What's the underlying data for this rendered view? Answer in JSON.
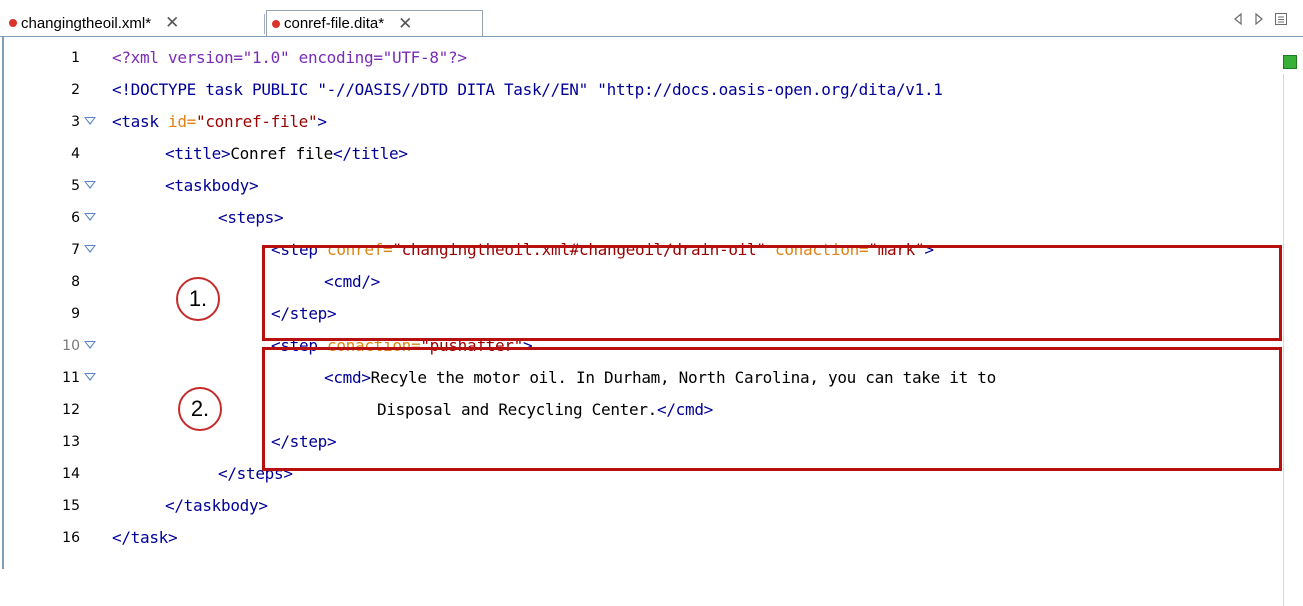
{
  "tabs": [
    {
      "label": "changingtheoil.xml*",
      "modified": true,
      "active": false
    },
    {
      "label": "conref-file.dita*",
      "modified": true,
      "active": true
    }
  ],
  "tab_close_glyph": "✕",
  "nav_icons": [
    "left-arrow-icon",
    "right-arrow-icon",
    "list-icon"
  ],
  "colors": {
    "tag": "#000099",
    "attr": "#e08214",
    "value": "#990000",
    "callout": "#b80f0f",
    "marker": "#38b038"
  },
  "lines": [
    {
      "n": "1",
      "segs": [
        [
          "pi",
          "<?xml version=\"1.0\" encoding=\"UTF-8\"?>"
        ]
      ]
    },
    {
      "n": "2",
      "segs": [
        [
          "dt",
          "<!DOCTYPE task PUBLIC \"-//OASIS//DTD DITA Task//EN\" \"http://docs.oasis-open.org/dita/v1.1"
        ]
      ]
    },
    {
      "n": "3",
      "fold": true,
      "segs": [
        [
          "t",
          "<task "
        ],
        [
          "a",
          "id="
        ],
        [
          "v",
          "\"conref-file\""
        ],
        [
          "t",
          ">"
        ]
      ]
    },
    {
      "n": "4",
      "indent": 1,
      "segs": [
        [
          "t",
          "<title>"
        ],
        [
          "txt",
          "Conref file"
        ],
        [
          "t",
          "</title>"
        ]
      ]
    },
    {
      "n": "5",
      "fold": true,
      "indent": 1,
      "segs": [
        [
          "t",
          "<taskbody>"
        ]
      ]
    },
    {
      "n": "6",
      "fold": true,
      "indent": 2,
      "segs": [
        [
          "t",
          "<steps>"
        ]
      ]
    },
    {
      "n": "7",
      "fold": true,
      "indent": 3,
      "segs": [
        [
          "t",
          "<step "
        ],
        [
          "a",
          "conref="
        ],
        [
          "v",
          "\"changingtheoil.xml#changeoil/drain-oil\""
        ],
        [
          "a",
          " conaction="
        ],
        [
          "v",
          "\"mark\""
        ],
        [
          "t",
          ">"
        ]
      ]
    },
    {
      "n": "8",
      "indent": 4,
      "segs": [
        [
          "t",
          "<cmd/>"
        ]
      ]
    },
    {
      "n": "9",
      "indent": 3,
      "segs": [
        [
          "t",
          "</step>"
        ]
      ]
    },
    {
      "n": "10",
      "dim": true,
      "fold": true,
      "indent": 3,
      "segs": [
        [
          "t",
          "<step "
        ],
        [
          "a",
          "conaction="
        ],
        [
          "v",
          "\"pushafter\""
        ],
        [
          "t",
          ">"
        ]
      ]
    },
    {
      "n": "11",
      "fold": true,
      "indent": 4,
      "segs": [
        [
          "t",
          "<cmd>"
        ],
        [
          "txt",
          "Recyle the motor oil. In Durham, North Carolina, you can take it to"
        ]
      ]
    },
    {
      "n": "12",
      "indent": 5,
      "segs": [
        [
          "txt",
          "Disposal and Recycling Center."
        ],
        [
          "t",
          "</cmd>"
        ]
      ]
    },
    {
      "n": "13",
      "indent": 3,
      "segs": [
        [
          "t",
          "</step>"
        ]
      ]
    },
    {
      "n": "14",
      "indent": 2,
      "segs": [
        [
          "t",
          "</steps>"
        ]
      ]
    },
    {
      "n": "15",
      "indent": 1,
      "segs": [
        [
          "t",
          "</taskbody>"
        ]
      ]
    },
    {
      "n": "16",
      "segs": [
        [
          "t",
          "</task>"
        ]
      ]
    }
  ],
  "callouts": [
    {
      "label": "1."
    },
    {
      "label": "2."
    }
  ]
}
